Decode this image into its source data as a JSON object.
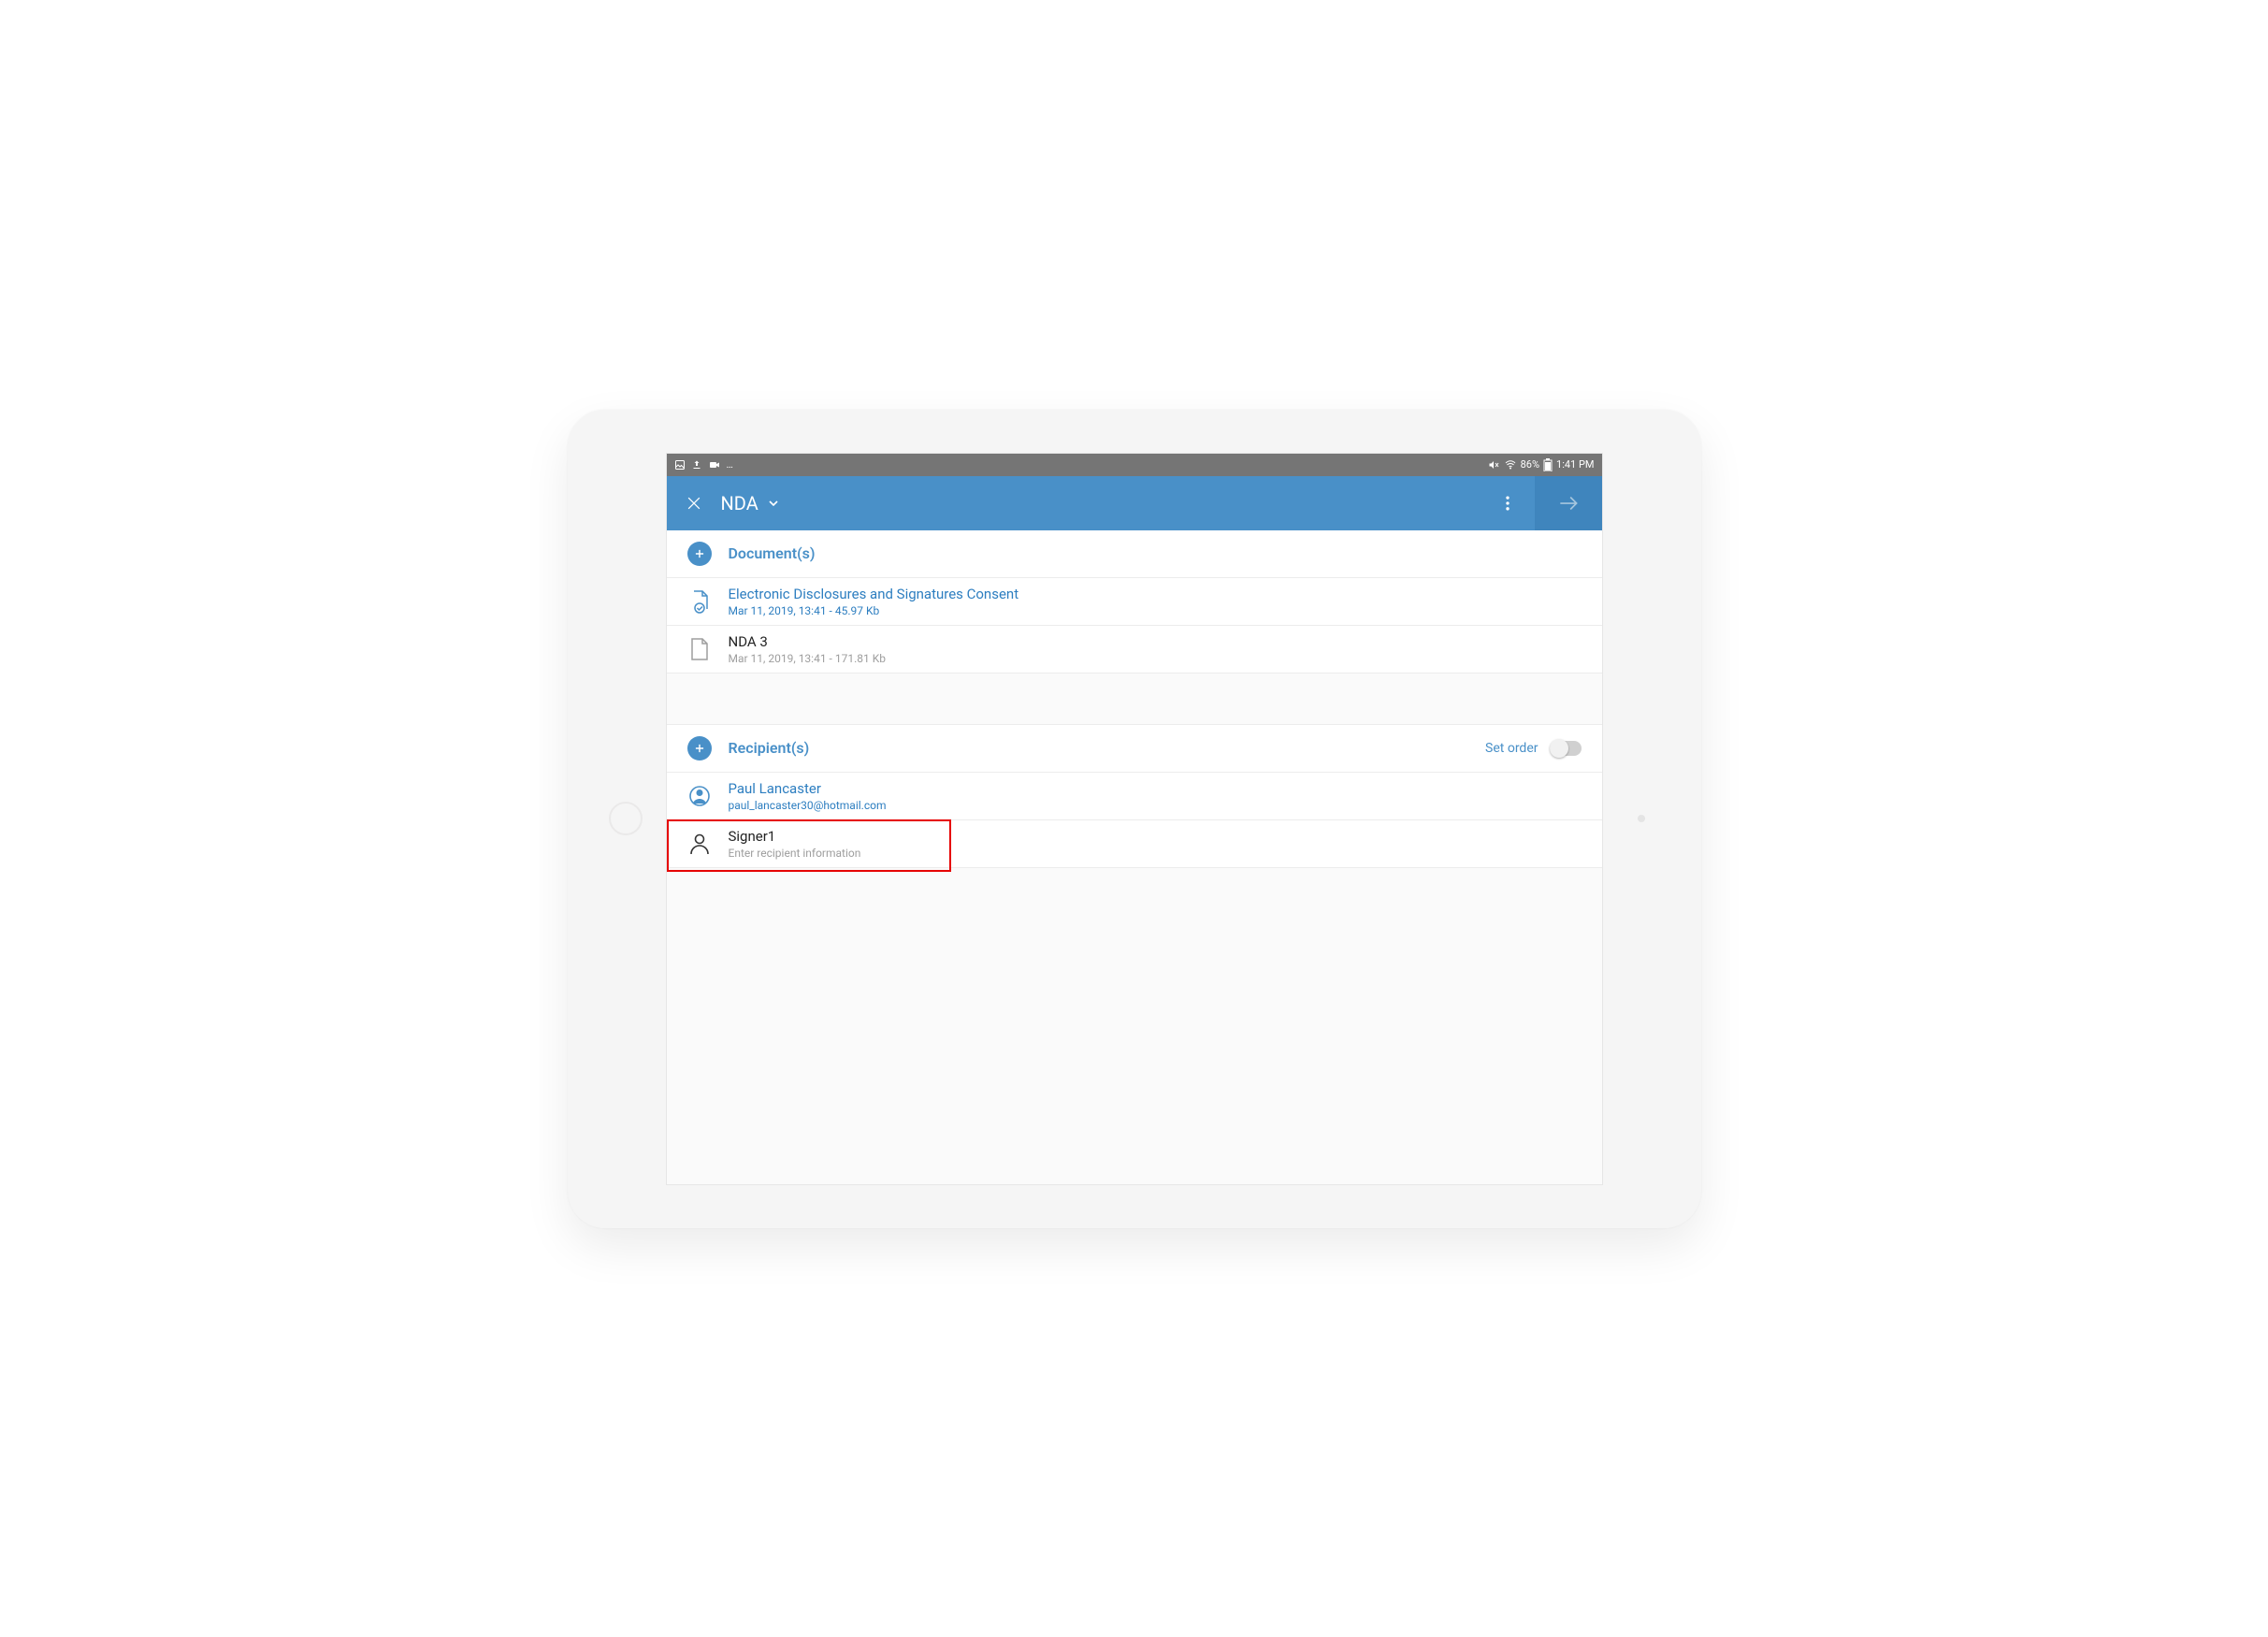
{
  "status_bar": {
    "battery": "86%",
    "time": "1:41 PM"
  },
  "app_bar": {
    "title": "NDA"
  },
  "sections": {
    "documents": {
      "label": "Document(s)",
      "items": [
        {
          "title": "Electronic Disclosures and Signatures Consent",
          "meta": "Mar 11, 2019, 13:41 - 45.97 Kb",
          "accent": true,
          "icon": "doc-check"
        },
        {
          "title": "NDA 3",
          "meta": "Mar 11, 2019, 13:41 - 171.81 Kb",
          "accent": false,
          "icon": "doc"
        }
      ]
    },
    "recipients": {
      "label": "Recipient(s)",
      "set_order_label": "Set order",
      "items": [
        {
          "title": "Paul Lancaster",
          "meta": "paul_lancaster30@hotmail.com",
          "accent": true,
          "icon": "avatar-filled"
        },
        {
          "title": "Signer1",
          "meta": "Enter recipient information",
          "accent": false,
          "icon": "avatar-outline",
          "highlighted": true
        }
      ]
    }
  }
}
